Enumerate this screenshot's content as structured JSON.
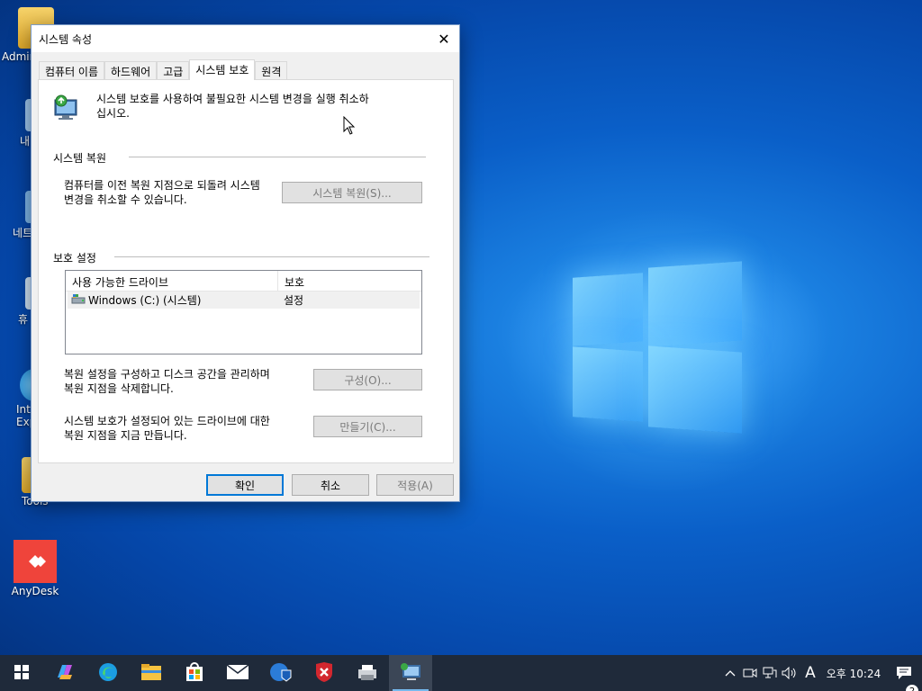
{
  "desktop": {
    "icons": [
      {
        "label": "Admin"
      },
      {
        "label": "내"
      },
      {
        "label": "네트"
      },
      {
        "label": "휴"
      },
      {
        "label": "Int Exp"
      },
      {
        "label": "Tools"
      },
      {
        "label": "AnyDesk"
      }
    ]
  },
  "dialog": {
    "title": "시스템 속성",
    "tabs": [
      {
        "label": "컴퓨터 이름"
      },
      {
        "label": "하드웨어"
      },
      {
        "label": "고급"
      },
      {
        "label": "시스템 보호"
      },
      {
        "label": "원격"
      }
    ],
    "active_tab": "시스템 보호",
    "intro_line1": "시스템 보호를 사용하여 불필요한 시스템 변경을 실행 취소하",
    "intro_line2": "십시오.",
    "restore_group": "시스템 복원",
    "restore_desc_line1": "컴퓨터를 이전 복원 지점으로 되돌려 시스템",
    "restore_desc_line2": "변경을 취소할 수 있습니다.",
    "restore_button": "시스템 복원(S)...",
    "protection_group": "보호 설정",
    "list_columns": [
      "사용 가능한 드라이브",
      "보호"
    ],
    "drives": [
      {
        "name": "Windows (C:) (시스템)",
        "protection": "설정"
      }
    ],
    "configure_desc_line1": "복원 설정을 구성하고 디스크 공간을 관리하며",
    "configure_desc_line2": "복원 지점을 삭제합니다.",
    "configure_button": "구성(O)...",
    "create_desc_line1": "시스템 보호가 설정되어 있는 드라이브에 대한",
    "create_desc_line2": "복원 지점을 지금 만듭니다.",
    "create_button": "만들기(C)...",
    "ok_button": "확인",
    "cancel_button": "취소",
    "apply_button": "적용(A)"
  },
  "taskbar": {
    "clock": "오후 10:24",
    "ime": "A",
    "notifications": "2"
  },
  "colors": {
    "accent": "#0078d7",
    "taskbar": "#1f2a3a",
    "dialog_bg": "#f0f0f0"
  }
}
